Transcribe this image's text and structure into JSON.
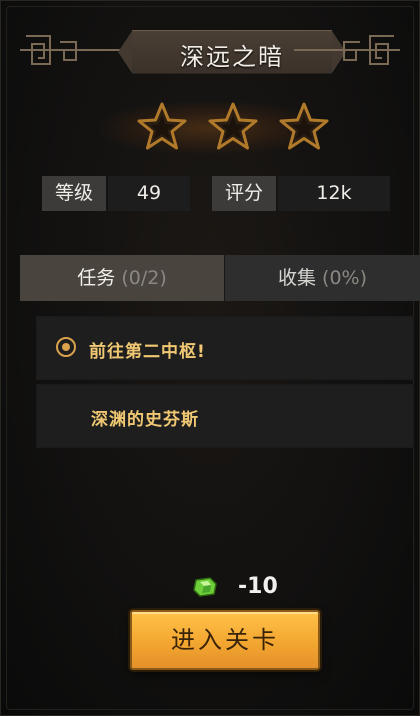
{
  "panel": {
    "title": "深远之暗"
  },
  "rating": {
    "stars_total": 3,
    "stars_earned": 0
  },
  "stats": {
    "level_label": "等级",
    "level_value": "49",
    "score_label": "评分",
    "score_value": "12k"
  },
  "tabs": [
    {
      "label": "任务",
      "count": "(0/2)",
      "active": true
    },
    {
      "label": "收集",
      "count": "(0%)",
      "active": false
    }
  ],
  "quests": [
    {
      "text": "前往第二中枢!",
      "icon": "target-icon"
    },
    {
      "text": "深渊的史芬斯",
      "icon": ""
    }
  ],
  "cost": {
    "icon": "energy-crystal-icon",
    "value": "-10"
  },
  "enter_button": {
    "label": "进入关卡"
  },
  "colors": {
    "accent_gold": "#f0c873",
    "button_orange": "#f3a630",
    "star_outline": "#b07a2a"
  }
}
